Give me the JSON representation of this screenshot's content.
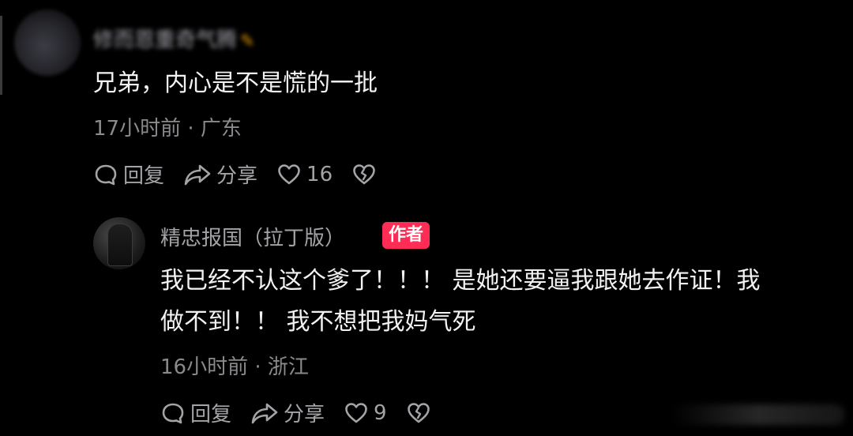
{
  "comments": [
    {
      "username": "修而恩重奇气腾",
      "flag_icon": "pencil-icon",
      "content": "兄弟，内心是不是慌的一批",
      "meta": "17小时前 · 广东",
      "reply_label": "回复",
      "share_label": "分享",
      "like_count": "16"
    },
    {
      "username": "精忠报国（拉丁版）",
      "badge": "作者",
      "content_line1": "我已经不认这个爹了！！！ 是她还要逼我跟她去作证！我",
      "content_line2": "做不到！！ 我不想把我妈气死",
      "meta": "16小时前 · 浙江",
      "reply_label": "回复",
      "share_label": "分享",
      "like_count": "9"
    }
  ],
  "colors": {
    "background": "#000000",
    "badge": "#ff2d55",
    "text": "#f2f2f2",
    "secondary": "#a3a3a8"
  }
}
